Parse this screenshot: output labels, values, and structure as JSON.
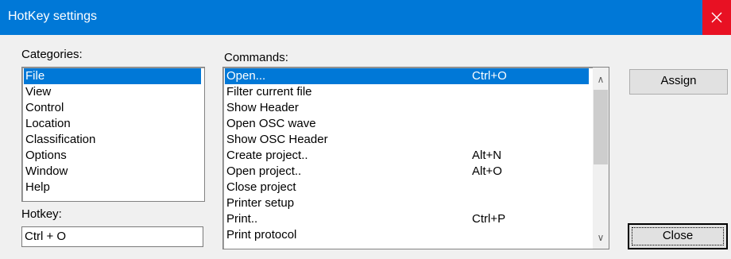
{
  "window": {
    "title": "HotKey settings",
    "close_icon": "close-icon"
  },
  "categories": {
    "label": "Categories:",
    "items": [
      "File",
      "View",
      "Control",
      "Location",
      "Classification",
      "Options",
      "Window",
      "Help"
    ],
    "selected": "File"
  },
  "commands": {
    "label": "Commands:",
    "items": [
      {
        "name": "Open...",
        "shortcut": "Ctrl+O"
      },
      {
        "name": "Filter current file",
        "shortcut": ""
      },
      {
        "name": "Show Header",
        "shortcut": ""
      },
      {
        "name": "Open OSC wave",
        "shortcut": ""
      },
      {
        "name": "Show OSC Header",
        "shortcut": ""
      },
      {
        "name": "Create project..",
        "shortcut": "Alt+N"
      },
      {
        "name": "Open project..",
        "shortcut": "Alt+O"
      },
      {
        "name": "Close project",
        "shortcut": ""
      },
      {
        "name": "Printer setup",
        "shortcut": ""
      },
      {
        "name": "Print..",
        "shortcut": "Ctrl+P"
      },
      {
        "name": "Print protocol",
        "shortcut": ""
      }
    ],
    "selected": "Open..."
  },
  "hotkey": {
    "label": "Hotkey:",
    "value": "Ctrl + O"
  },
  "buttons": {
    "assign": "Assign",
    "close": "Close"
  },
  "colors": {
    "titlebar": "#0078d7",
    "selection": "#0078d7",
    "close_hover": "#e81123"
  }
}
